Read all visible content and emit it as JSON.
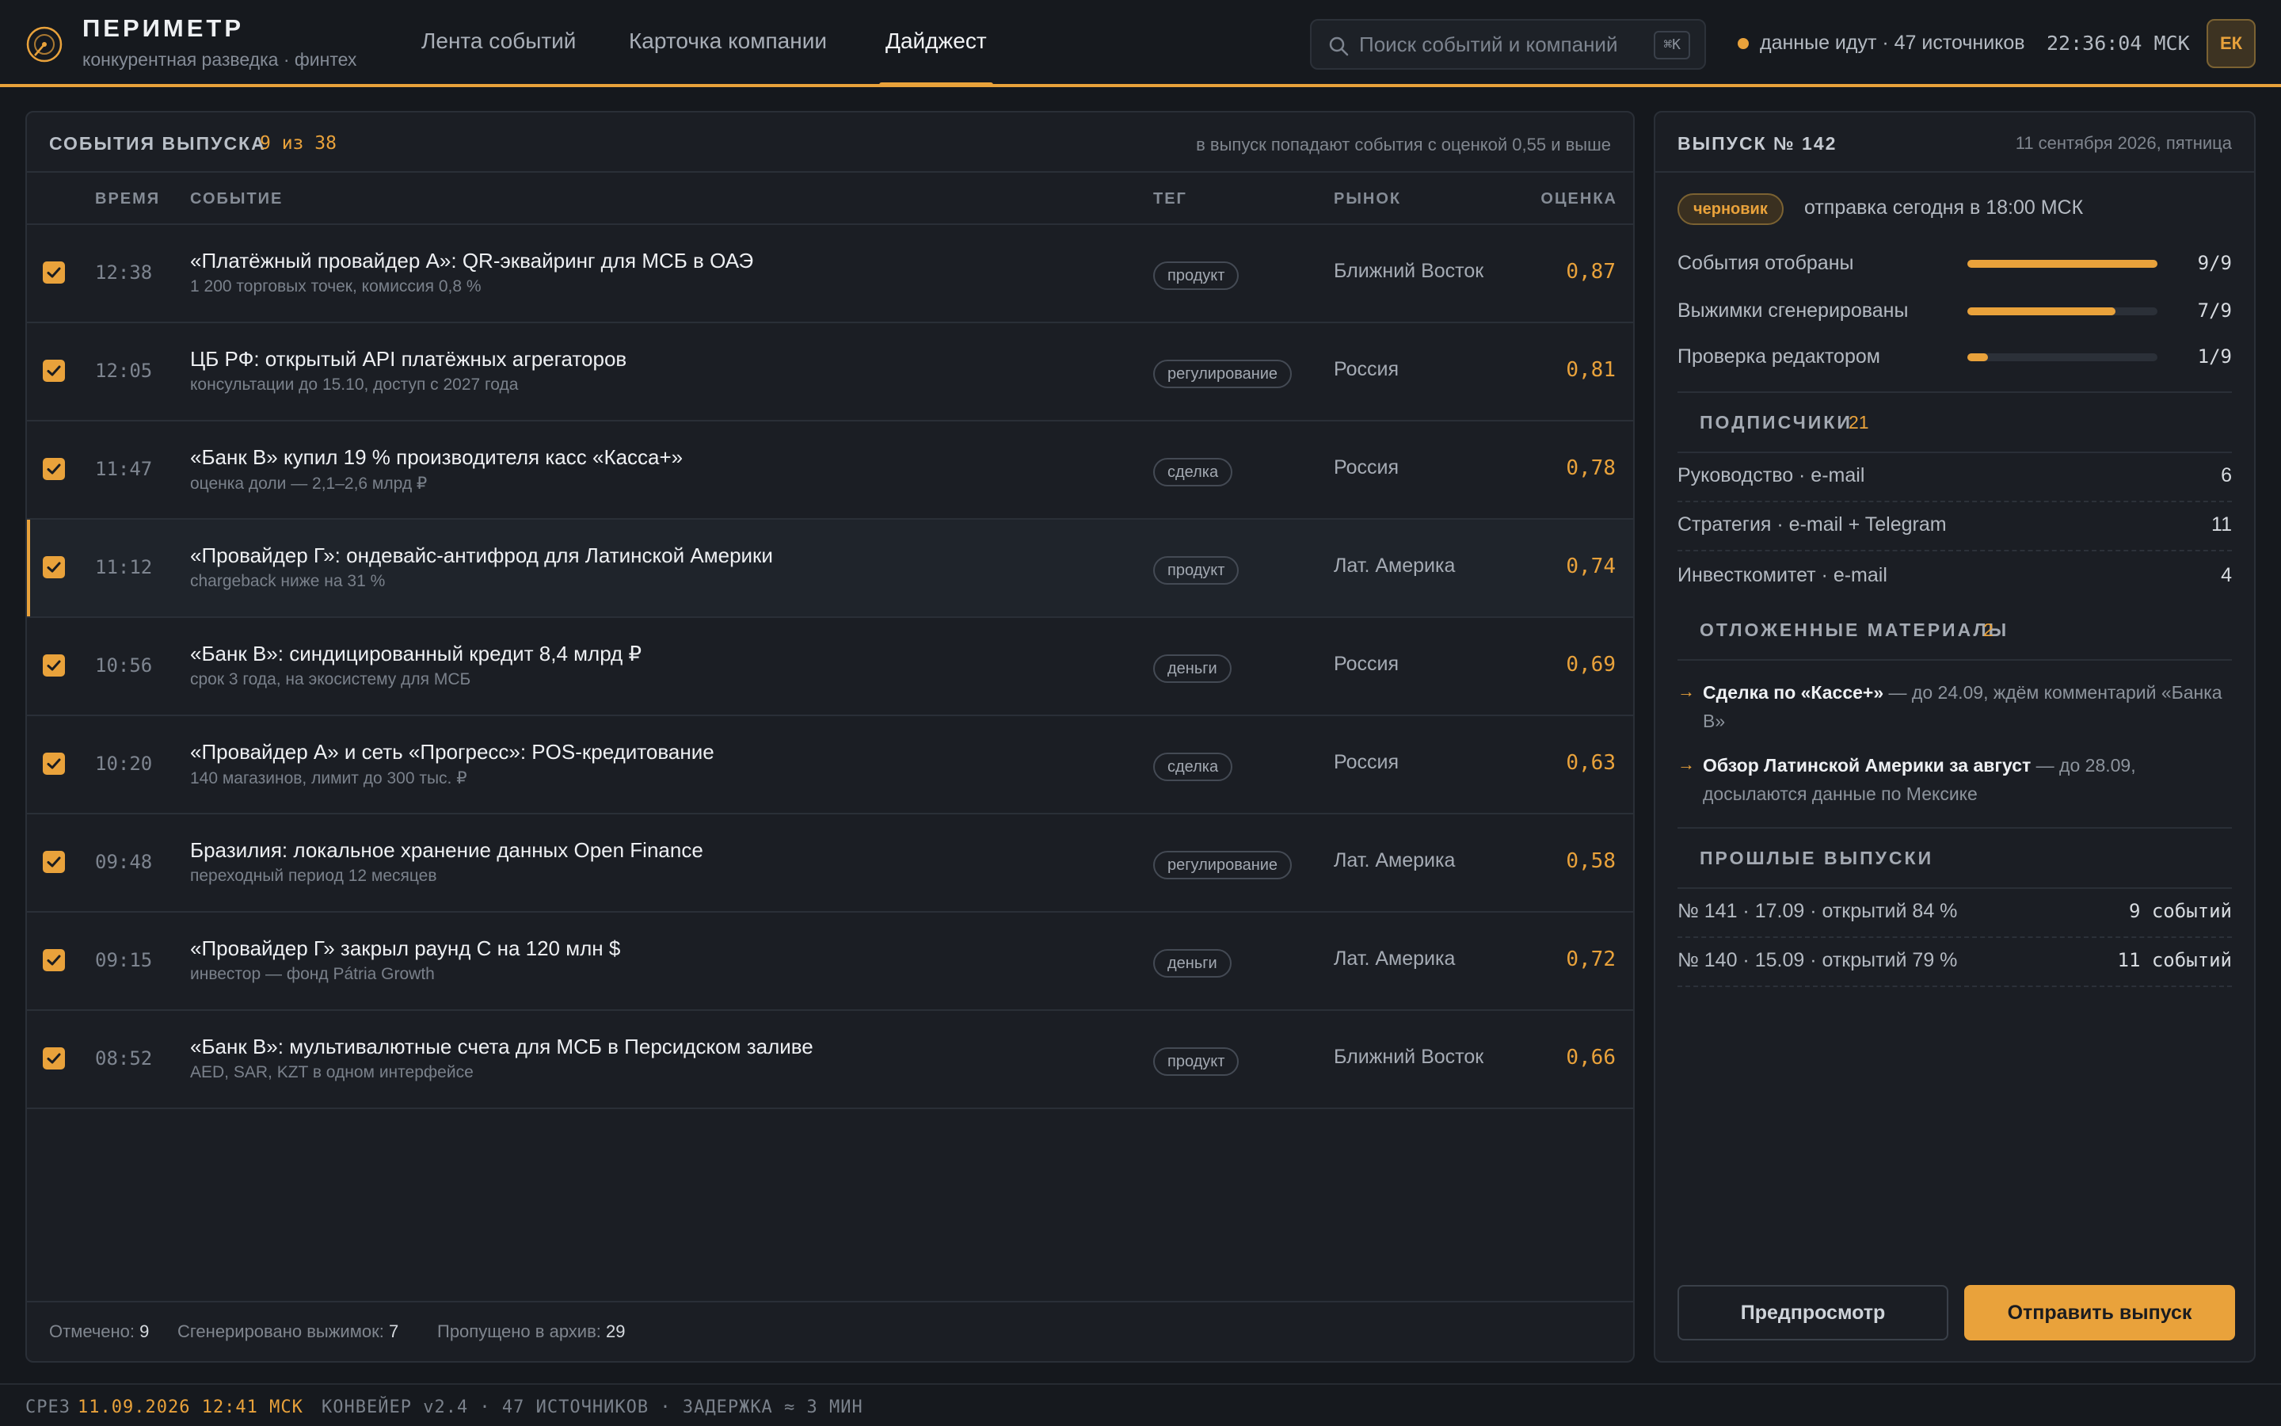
{
  "brand": {
    "name": "ПЕРИМЕТР",
    "subtitle": "конкурентная разведка · финтех",
    "logo_icon": "radar-icon"
  },
  "nav": {
    "tabs": [
      {
        "label": "Лента событий",
        "active": false
      },
      {
        "label": "Карточка компании",
        "active": false
      },
      {
        "label": "Дайджест",
        "active": true
      }
    ]
  },
  "search": {
    "placeholder": "Поиск событий и компаний",
    "value": "",
    "shortcut": "⌘K"
  },
  "header_status": {
    "feed": "данные идут · 47 источников",
    "clock": "22:36:04 МСК",
    "avatar_initials": "ЕК"
  },
  "events": {
    "title": "СОБЫТИЯ ВЫПУСКА",
    "count": "9 из 38",
    "note": "в выпуск попадают события с оценкой 0,55 и выше",
    "columns": {
      "time": "ВРЕМЯ",
      "event": "СОБЫТИЕ",
      "tag": "ТЕГ",
      "market": "РЫНОК",
      "score": "ОЦЕНКА"
    },
    "rows": [
      {
        "checked": true,
        "time": "12:38",
        "title": "«Платёжный провайдер А»: QR-эквайринг для МСБ в ОАЭ",
        "sub": "1 200 торговых точек, комиссия 0,8 %",
        "tag": "продукт",
        "market": "Ближний Восток",
        "score": "0,87"
      },
      {
        "checked": true,
        "time": "12:05",
        "title": "ЦБ РФ: открытый API платёжных агрегаторов",
        "sub": "консультации до 15.10, доступ с 2027 года",
        "tag": "регулирование",
        "market": "Россия",
        "score": "0,81"
      },
      {
        "checked": true,
        "time": "11:47",
        "title": "«Банк В» купил 19 % производителя касс «Касса+»",
        "sub": "оценка доли — 2,1–2,6 млрд ₽",
        "tag": "сделка",
        "market": "Россия",
        "score": "0,78"
      },
      {
        "checked": true,
        "time": "11:12",
        "title": "«Провайдер Г»: ондевайс-антифрод для Латинской Америки",
        "sub": "chargeback ниже на 31 %",
        "tag": "продукт",
        "market": "Лат. Америка",
        "score": "0,74",
        "selected": true
      },
      {
        "checked": true,
        "time": "10:56",
        "title": "«Банк В»: синдицированный кредит 8,4 млрд ₽",
        "sub": "срок 3 года, на экосистему для МСБ",
        "tag": "деньги",
        "market": "Россия",
        "score": "0,69"
      },
      {
        "checked": true,
        "time": "10:20",
        "title": "«Провайдер А» и сеть «Прогресс»: POS-кредитование",
        "sub": "140 магазинов, лимит до 300 тыс. ₽",
        "tag": "сделка",
        "market": "Россия",
        "score": "0,63"
      },
      {
        "checked": true,
        "time": "09:48",
        "title": "Бразилия: локальное хранение данных Open Finance",
        "sub": "переходный период 12 месяцев",
        "tag": "регулирование",
        "market": "Лат. Америка",
        "score": "0,58"
      },
      {
        "checked": true,
        "time": "09:15",
        "title": "«Провайдер Г» закрыл раунд С на 120 млн $",
        "sub": "инвестор — фонд Pátria Growth",
        "tag": "деньги",
        "market": "Лат. Америка",
        "score": "0,72"
      },
      {
        "checked": true,
        "time": "08:52",
        "title": "«Банк В»: мультивалютные счета для МСБ в Персидском заливе",
        "sub": "AED, SAR, KZT в одном интерфейсе",
        "tag": "продукт",
        "market": "Ближний Восток",
        "score": "0,66"
      }
    ],
    "footer": {
      "marked_label": "Отмечено:",
      "marked_value": "9",
      "generated_label": "Сгенерировано выжимок:",
      "generated_value": "7",
      "archived_label": "Пропущено в архив:",
      "archived_value": "29"
    }
  },
  "issue": {
    "title": "ВЫПУСК № 142",
    "date": "11 сентября 2026, пятница",
    "status_badge": "черновик",
    "send_time": "отправка сегодня в 18:00 МСК",
    "progress": [
      {
        "label": "События отобраны",
        "value": "9/9",
        "fraction": 1.0
      },
      {
        "label": "Выжимки сгенерированы",
        "value": "7/9",
        "fraction": 0.78
      },
      {
        "label": "Проверка редактором",
        "value": "1/9",
        "fraction": 0.11
      }
    ],
    "subscribers": {
      "title": "ПОДПИСЧИКИ",
      "count": "21",
      "groups": [
        {
          "label": "Руководство · e-mail",
          "value": "6"
        },
        {
          "label": "Стратегия · e-mail + Telegram",
          "value": "11"
        },
        {
          "label": "Инвесткомитет · e-mail",
          "value": "4"
        }
      ]
    },
    "deferred": {
      "title": "ОТЛОЖЕННЫЕ МАТЕРИАЛЫ",
      "count": "2",
      "items": [
        {
          "head": "Сделка по «Кассе+»",
          "rest": " — до 24.09, ждём комментарий «Банка В»"
        },
        {
          "head": "Обзор Латинской Америки за август",
          "rest": " — до 28.09, досылаются данные по Мексике"
        }
      ]
    },
    "past": {
      "title": "ПРОШЛЫЕ ВЫПУСКИ",
      "items": [
        {
          "label": "№ 141 · 17.09 · открытий 84 %",
          "value": "9 событий"
        },
        {
          "label": "№ 140 · 15.09 · открытий 79 %",
          "value": "11 событий"
        }
      ]
    },
    "buttons": {
      "preview": "Предпросмотр",
      "send": "Отправить выпуск"
    }
  },
  "statusbar": {
    "slice_label": "СРЕЗ",
    "slice_value": "11.09.2026 12:41 МСК",
    "pipeline": "КОНВЕЙЕР v2.4 · 47 ИСТОЧНИКОВ · ЗАДЕРЖКА ≈ 3 МИН"
  },
  "colors": {
    "accent": "#e9a23b",
    "background": "#15181d",
    "panel": "#1b1e24"
  }
}
